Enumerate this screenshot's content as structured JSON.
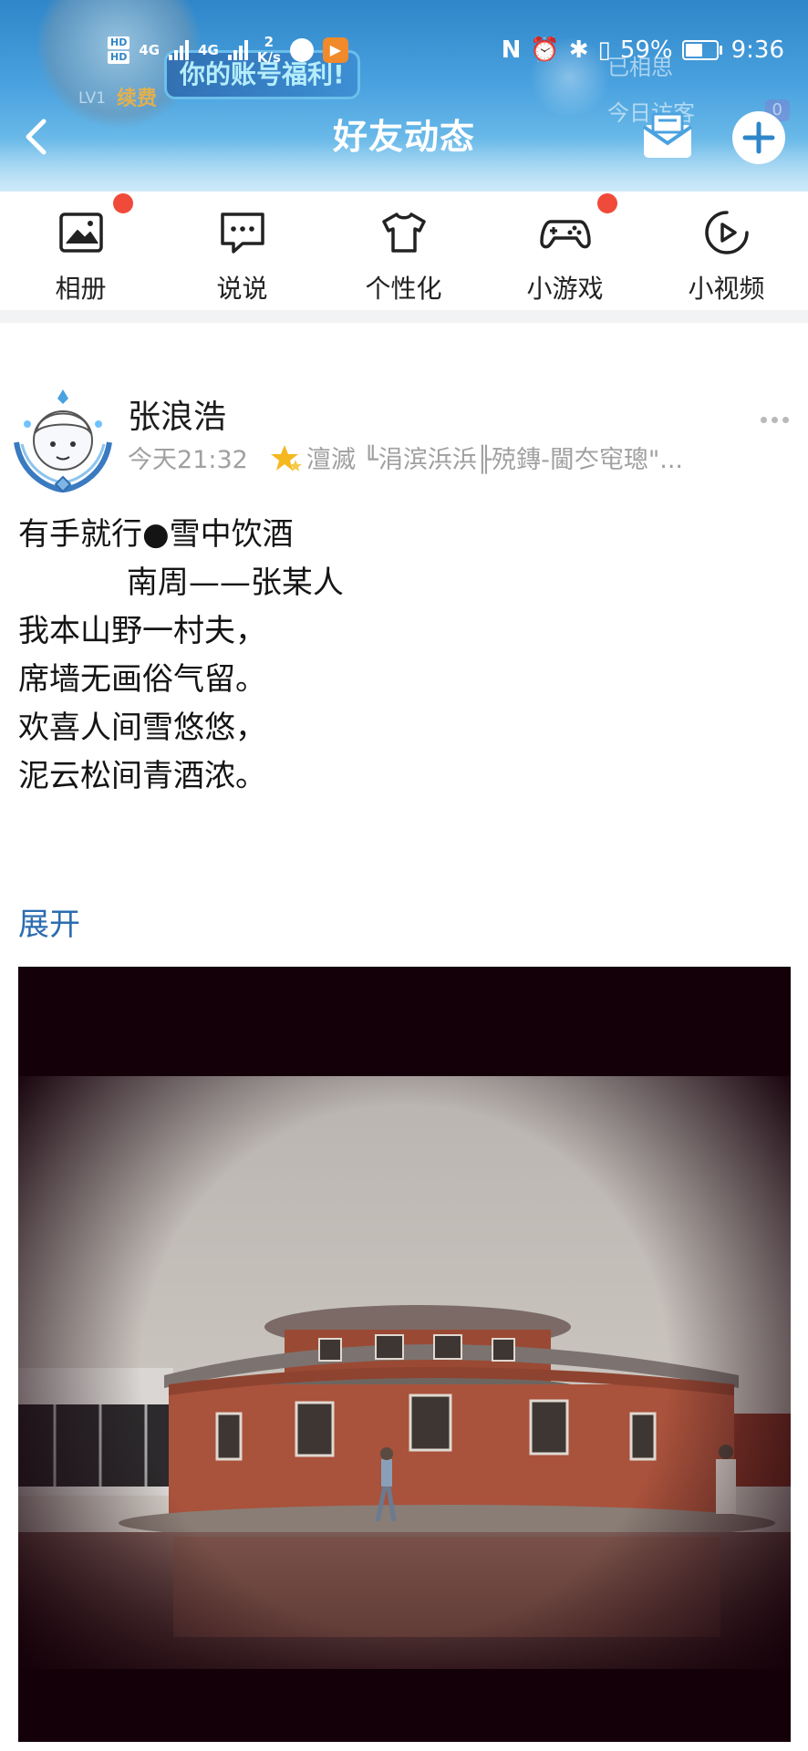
{
  "status_bar": {
    "hd_1": "HD",
    "hd_2": "HD",
    "net_1": "4G",
    "net_2": "4G",
    "speed_value": "2",
    "speed_unit": "K/s",
    "nfc": "N",
    "battery_text": "59%",
    "battery_level": 0.59,
    "time": "9:36"
  },
  "header": {
    "title": "好友动态",
    "banner_text": "你的账号福利!",
    "renew_label": "续费",
    "level_label": "LV1",
    "stats": [
      {
        "label": "已相思",
        "count": ""
      },
      {
        "label": "今日访客",
        "count": "0"
      }
    ]
  },
  "shortcuts": [
    {
      "label": "相册",
      "icon": "photo-album-icon",
      "badge": true
    },
    {
      "label": "说说",
      "icon": "chat-bubble-icon",
      "badge": false
    },
    {
      "label": "个性化",
      "icon": "tshirt-icon",
      "badge": false
    },
    {
      "label": "小游戏",
      "icon": "gamepad-icon",
      "badge": true
    },
    {
      "label": "小视频",
      "icon": "video-play-icon",
      "badge": false
    }
  ],
  "post": {
    "author": "张浪浩",
    "time": "今天21:32",
    "device": "澶滅 ╙涓滨浜浜╟殑鏄-閫冭窀璁\"...",
    "body": "有手就行●雪中饮酒\n           南周——张某人\n我本山野一村夫，\n席墙无画俗气留。\n欢喜人间雪悠悠，\n泥云松间青酒浓。",
    "expand_label": "展开"
  },
  "colors": {
    "header_blue": "#2f86c9",
    "badge_red": "#f04a3a",
    "link_blue": "#2b6cb0",
    "muted_gray": "#a0a0a0"
  }
}
